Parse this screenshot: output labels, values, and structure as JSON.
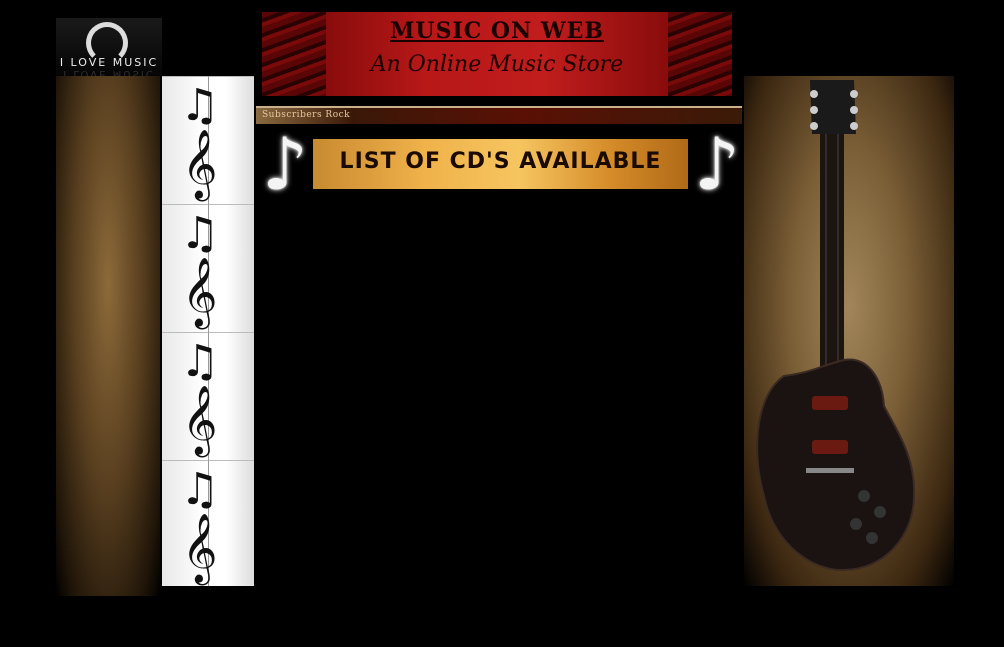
{
  "logo": {
    "text": "I LOVE MUSIC"
  },
  "header": {
    "title": "MUSIC ON WEB",
    "subtitle": "An Online Music Store"
  },
  "subscribers_bar": {
    "label": "Subscribers Rock"
  },
  "cd_banner": {
    "label": "LIST OF CD'S AVAILABLE"
  },
  "colors": {
    "background": "#000000",
    "banner_red": "#c11d1d",
    "cd_banner_gold": "#f0b24a"
  },
  "icons": [
    "headphones-icon",
    "treble-clef-icon",
    "eighth-note-icon",
    "guitar-image"
  ]
}
